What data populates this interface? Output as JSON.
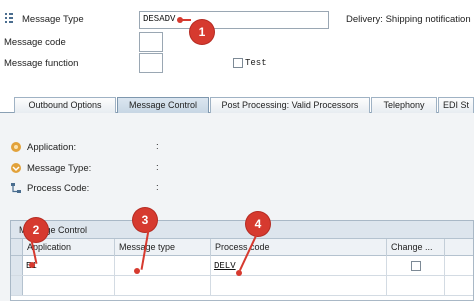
{
  "header": {
    "message_type_label": "Message Type",
    "message_type_value": "DESADV",
    "message_type_description": "Delivery: Shipping notification",
    "message_code_label": "Message code",
    "message_code_value": "",
    "message_function_label": "Message function",
    "message_function_value": "",
    "test_label": "Test"
  },
  "tabs": [
    {
      "label": "Outbound Options"
    },
    {
      "label": "Message Control"
    },
    {
      "label": "Post Processing: Valid Processors"
    },
    {
      "label": "Telephony"
    },
    {
      "label": "EDI St"
    }
  ],
  "active_tab": "Message Control",
  "panel": {
    "application_label": "Application:",
    "message_type_label": "Message Type:",
    "process_code_label": "Process Code:",
    "colon": ":"
  },
  "table": {
    "title": "Message Control",
    "columns": [
      "Application",
      "Message type",
      "Process code",
      "Change ..."
    ],
    "rows": [
      {
        "application": "E1",
        "message_type": "",
        "process_code": "DELV",
        "change": false
      },
      {
        "application": "",
        "message_type": "",
        "process_code": "",
        "change": false
      }
    ]
  },
  "annotations": [
    "1",
    "2",
    "3",
    "4"
  ],
  "colors": {
    "marker": "#d63a2f",
    "tab_active": "#c7d6e4",
    "panel_bg": "#f2f4f6"
  }
}
